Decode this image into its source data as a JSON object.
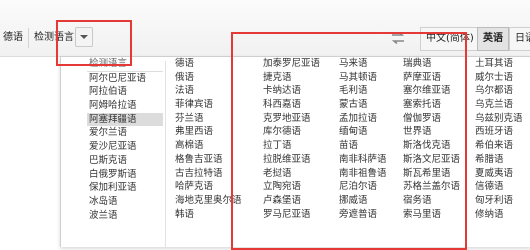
{
  "toolbar": {
    "source_lang_label": "德语",
    "detect_label": "检测语言",
    "target_buttons": [
      {
        "label": "中文(简体)",
        "active": false
      },
      {
        "label": "英语",
        "active": true
      },
      {
        "label": "日语",
        "active": false
      }
    ]
  },
  "panel": {
    "left_column": {
      "detect_item": "检测语言",
      "items": [
        "阿尔巴尼亚语",
        "阿拉伯语",
        "阿姆哈拉语",
        "阿塞拜疆语",
        "爱尔兰语",
        "爱沙尼亚语",
        "巴斯克语",
        "白俄罗斯语",
        "保加利亚语",
        "冰岛语",
        "波兰语"
      ],
      "selected": "阿塞拜疆语"
    },
    "columns": [
      [
        "德语",
        "俄语",
        "法语",
        "菲律宾语",
        "芬兰语",
        "弗里西语",
        "高棉语",
        "格鲁吉亚语",
        "古吉拉特语",
        "哈萨克语",
        "海地克里奥尔语",
        "韩语"
      ],
      [
        "加泰罗尼亚语",
        "捷克语",
        "卡纳达语",
        "科西嘉语",
        "克罗地亚语",
        "库尔德语",
        "拉丁语",
        "拉脱维亚语",
        "老挝语",
        "立陶宛语",
        "卢森堡语",
        "罗马尼亚语"
      ],
      [
        "马来语",
        "马其顿语",
        "毛利语",
        "蒙古语",
        "孟加拉语",
        "缅甸语",
        "苗语",
        "南非科萨语",
        "南非祖鲁语",
        "尼泊尔语",
        "挪威语",
        "旁遮普语"
      ],
      [
        "瑞典语",
        "萨摩亚语",
        "塞尔维亚语",
        "塞索托语",
        "僧伽罗语",
        "世界语",
        "斯洛伐克语",
        "斯洛文尼亚语",
        "斯瓦希里语",
        "苏格兰盖尔语",
        "宿务语",
        "索马里语"
      ],
      [
        "土耳其语",
        "威尔士语",
        "乌尔都语",
        "乌克兰语",
        "乌兹别克语",
        "西班牙语",
        "希伯来语",
        "希腊语",
        "夏威夷语",
        "信德语",
        "匈牙利语",
        "修纳语"
      ]
    ]
  },
  "colors": {
    "highlight": "#e53935",
    "selected_bg": "#dcdcdc"
  }
}
